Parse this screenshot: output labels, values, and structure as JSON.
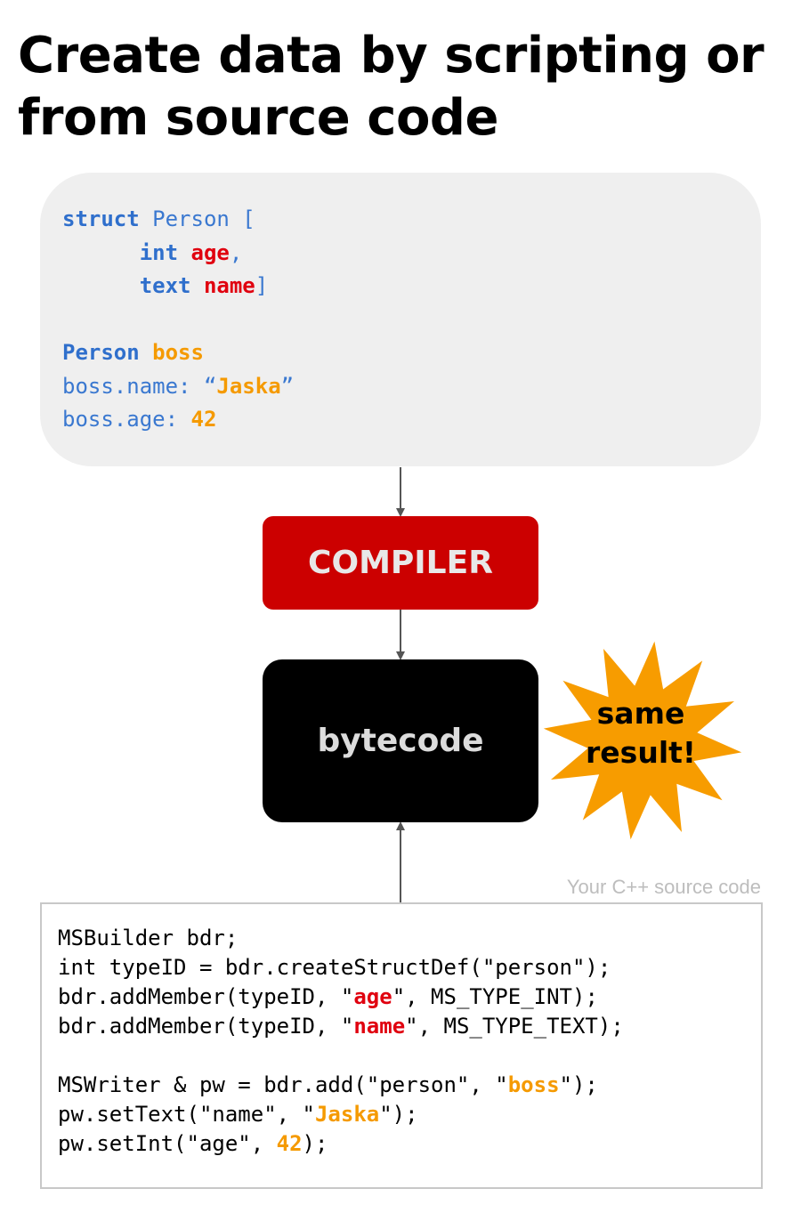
{
  "title": {
    "line1": "Create data by scripting or",
    "line2": "from source code"
  },
  "script": {
    "l1_kw": "struct",
    "l1_rest": " Person [",
    "l2_indent": "      ",
    "l2_kw": "int",
    "l2_field": "age",
    "l2_end": ",",
    "l3_indent": "      ",
    "l3_kw": "text",
    "l3_field": "name",
    "l3_end": "]",
    "l5_type": "Person",
    "l5_var": "boss",
    "l6_prefix": "boss.name: “",
    "l6_value": "Jaska",
    "l6_suffix": "”",
    "l7_prefix": "boss.age: ",
    "l7_value": "42"
  },
  "compiler_label": "COMPILER",
  "bytecode_label": "bytecode",
  "burst": {
    "line1": "same",
    "line2": "result!",
    "color": "#f79c00"
  },
  "source": {
    "caption": "Your C++ source code",
    "l1": "MSBuilder bdr;",
    "l2": "int typeID = bdr.createStructDef(\"person\");",
    "l3_a": "bdr.addMember(typeID, \"",
    "l3_hl": "age",
    "l3_b": "\", MS_TYPE_INT);",
    "l4_a": "bdr.addMember(typeID, \"",
    "l4_hl": "name",
    "l4_b": "\", MS_TYPE_TEXT);",
    "l6_a": "MSWriter & pw = bdr.add(\"person\", \"",
    "l6_hl": "boss",
    "l6_b": "\");",
    "l7_a": "pw.setText(\"name\", \"",
    "l7_hl": "Jaska",
    "l7_b": "\");",
    "l8_a": "pw.setInt(\"age\", ",
    "l8_hl": "42",
    "l8_b": ");"
  },
  "colors": {
    "compiler": "#cc0000",
    "bytecode": "#000000",
    "keyword": "#2f6fcc",
    "field": "#e0000f",
    "value": "#f59a00"
  }
}
